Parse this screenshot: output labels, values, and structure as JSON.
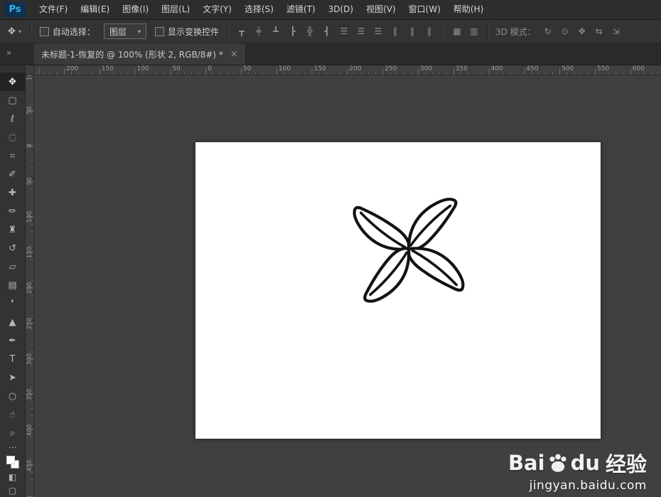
{
  "menubar": {
    "logo": "Ps",
    "menus": [
      {
        "label": "文件(F)"
      },
      {
        "label": "编辑(E)"
      },
      {
        "label": "图像(I)"
      },
      {
        "label": "图层(L)"
      },
      {
        "label": "文字(Y)"
      },
      {
        "label": "选择(S)"
      },
      {
        "label": "滤镜(T)"
      },
      {
        "label": "3D(D)"
      },
      {
        "label": "视图(V)"
      },
      {
        "label": "窗口(W)"
      },
      {
        "label": "帮助(H)"
      }
    ]
  },
  "options": {
    "tool_icon": "✥",
    "tool_caret": "▾",
    "auto_select_label": "自动选择：",
    "target_value": "图层",
    "target_caret": "▾",
    "show_transform_label": "显示变换控件",
    "align_icons": [
      {
        "glyph": "┳",
        "name": "align-top-edges-icon"
      },
      {
        "glyph": "╪",
        "name": "align-vertical-centers-icon"
      },
      {
        "glyph": "┻",
        "name": "align-bottom-edges-icon"
      },
      {
        "glyph": "┣",
        "name": "align-left-edges-icon"
      },
      {
        "glyph": "╬",
        "name": "align-horizontal-centers-icon"
      },
      {
        "glyph": "┫",
        "name": "align-right-edges-icon"
      },
      {
        "glyph": "☰",
        "name": "distribute-top-edges-icon"
      },
      {
        "glyph": "☰",
        "name": "distribute-vertical-centers-icon"
      },
      {
        "glyph": "☰",
        "name": "distribute-bottom-edges-icon"
      },
      {
        "glyph": "‖",
        "name": "distribute-left-edges-icon"
      },
      {
        "glyph": "‖",
        "name": "distribute-horizontal-centers-icon"
      },
      {
        "glyph": "‖",
        "name": "distribute-right-edges-icon"
      }
    ],
    "extra_icons": [
      {
        "glyph": "▦",
        "name": "auto-align-layers-icon"
      },
      {
        "glyph": "▥",
        "name": "auto-distribute-icon"
      }
    ],
    "mode3d_label": "3D 模式：",
    "mode3d_icons": [
      {
        "glyph": "↻",
        "name": "3d-rotate-icon"
      },
      {
        "glyph": "⊙",
        "name": "3d-roll-icon"
      },
      {
        "glyph": "✥",
        "name": "3d-drag-icon"
      },
      {
        "glyph": "⇆",
        "name": "3d-slide-icon"
      },
      {
        "glyph": "⇲",
        "name": "3d-scale-icon"
      }
    ]
  },
  "tabbar": {
    "collapse_glyph": "»",
    "tab_title": "未标题-1-恢复的 @ 100% (形状 2, RGB/8#) *",
    "tab_close": "×"
  },
  "rulers": {
    "horizontal": [
      {
        "label": "200"
      },
      {
        "label": "150"
      },
      {
        "label": "100"
      },
      {
        "label": "50"
      },
      {
        "label": "0"
      },
      {
        "label": "50"
      },
      {
        "label": "100"
      },
      {
        "label": "150"
      },
      {
        "label": "200"
      },
      {
        "label": "250"
      },
      {
        "label": "300"
      },
      {
        "label": "350"
      },
      {
        "label": "400"
      },
      {
        "label": "450"
      },
      {
        "label": "500"
      },
      {
        "label": "550"
      },
      {
        "label": "600"
      }
    ],
    "vertical": [
      {
        "label": "100"
      },
      {
        "label": "50"
      },
      {
        "label": "0"
      },
      {
        "label": "50"
      },
      {
        "label": "100"
      },
      {
        "label": "150"
      },
      {
        "label": "200"
      },
      {
        "label": "250"
      },
      {
        "label": "300"
      },
      {
        "label": "350"
      },
      {
        "label": "400"
      },
      {
        "label": "450"
      }
    ]
  },
  "toolbar": {
    "tools": [
      {
        "glyph": "✥",
        "name": "move-tool",
        "active": true
      },
      {
        "glyph": "▢",
        "name": "rectangular-marquee-tool"
      },
      {
        "glyph": "ℓ",
        "name": "lasso-tool"
      },
      {
        "glyph": "◌",
        "name": "quick-selection-tool"
      },
      {
        "glyph": "⌗",
        "name": "crop-tool"
      },
      {
        "glyph": "✐",
        "name": "eyedropper-tool"
      },
      {
        "glyph": "✚",
        "name": "spot-healing-brush-tool"
      },
      {
        "glyph": "✏",
        "name": "brush-tool"
      },
      {
        "glyph": "♜",
        "name": "clone-stamp-tool"
      },
      {
        "glyph": "↺",
        "name": "history-brush-tool"
      },
      {
        "glyph": "▱",
        "name": "eraser-tool"
      },
      {
        "glyph": "▤",
        "name": "gradient-tool"
      },
      {
        "glyph": "❜",
        "name": "blur-tool"
      },
      {
        "glyph": "▲",
        "name": "dodge-tool"
      },
      {
        "glyph": "✒",
        "name": "pen-tool"
      },
      {
        "glyph": "T",
        "name": "type-tool"
      },
      {
        "glyph": "➤",
        "name": "path-selection-tool"
      },
      {
        "glyph": "○",
        "name": "ellipse-tool"
      },
      {
        "glyph": "☝",
        "name": "hand-tool"
      },
      {
        "glyph": "⌕",
        "name": "zoom-tool"
      }
    ],
    "more_glyph": "⋯",
    "swatch_fg": "#ffffff",
    "swatch_bg": "#ffffff",
    "mask_glyph": "◧",
    "screen_glyph": "▢"
  },
  "canvas": {
    "doc_color": "#ffffff",
    "line_color": "#121212",
    "zoom_level": "100%"
  },
  "watermark": {
    "brand_left": "Bai",
    "brand_right": "du",
    "brand_cn": "经验",
    "url": "jingyan.baidu.com"
  },
  "colors": {
    "accent": "#31a8ff",
    "chrome_bg": "#333333",
    "canvas_bg": "#404040"
  }
}
